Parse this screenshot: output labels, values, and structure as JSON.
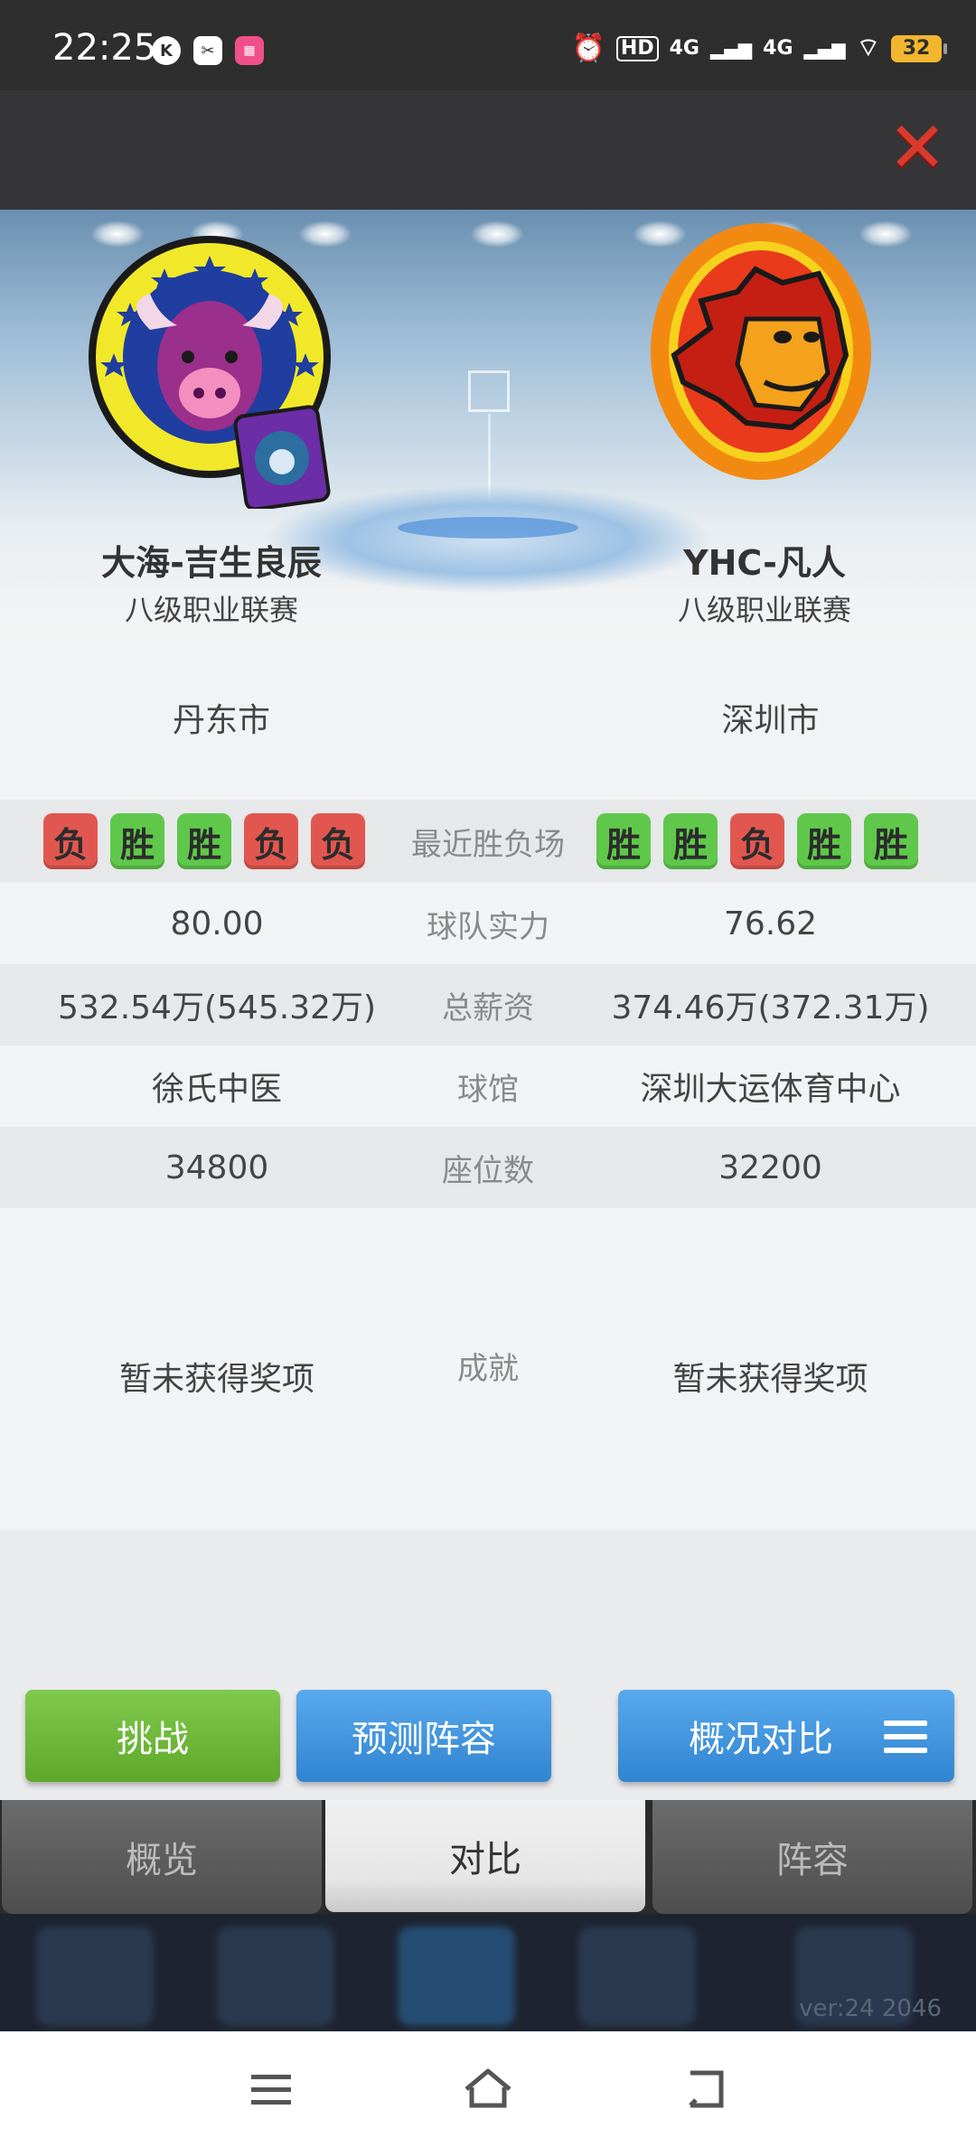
{
  "status_bar": {
    "time": "22:25",
    "left_icons": [
      "k-icon",
      "scissors-icon",
      "pink-app-icon"
    ],
    "network_hd": "HD",
    "net1": "4G",
    "net2": "4G",
    "battery": "32"
  },
  "header": {
    "close_icon": "close-icon"
  },
  "teams": {
    "left": {
      "name": "大海-吉生良辰",
      "league": "八级职业联赛",
      "city": "丹东市"
    },
    "right": {
      "name": "YHC-凡人",
      "league": "八级职业联赛",
      "city": "深圳市"
    }
  },
  "comparison": {
    "recent": {
      "label": "最近胜负场",
      "left": [
        "负",
        "胜",
        "胜",
        "负",
        "负"
      ],
      "right": [
        "胜",
        "胜",
        "负",
        "胜",
        "胜"
      ]
    },
    "strength": {
      "label": "球队实力",
      "left": "80.00",
      "right": "76.62"
    },
    "salary": {
      "label": "总薪资",
      "left": "532.54万(545.32万)",
      "right": "374.46万(372.31万)"
    },
    "arena": {
      "label": "球馆",
      "left": "徐氏中医",
      "right": "深圳大运体育中心"
    },
    "seats": {
      "label": "座位数",
      "left": "34800",
      "right": "32200"
    },
    "achievements": {
      "label": "成就",
      "left": "暂未获得奖项",
      "right": "暂未获得奖项"
    }
  },
  "actions": {
    "challenge": "挑战",
    "predict_lineup": "预测阵容",
    "overview_compare": "概况对比"
  },
  "tabs": [
    {
      "label": "概览"
    },
    {
      "label": "对比"
    },
    {
      "label": "阵容"
    }
  ],
  "dock": {
    "version": "ver:24  2046"
  },
  "colors": {
    "win": "#5fc84a",
    "loss": "#e1574f",
    "green_button": "#6cb637",
    "blue_button": "#3f96df",
    "close": "#d93a2e"
  }
}
